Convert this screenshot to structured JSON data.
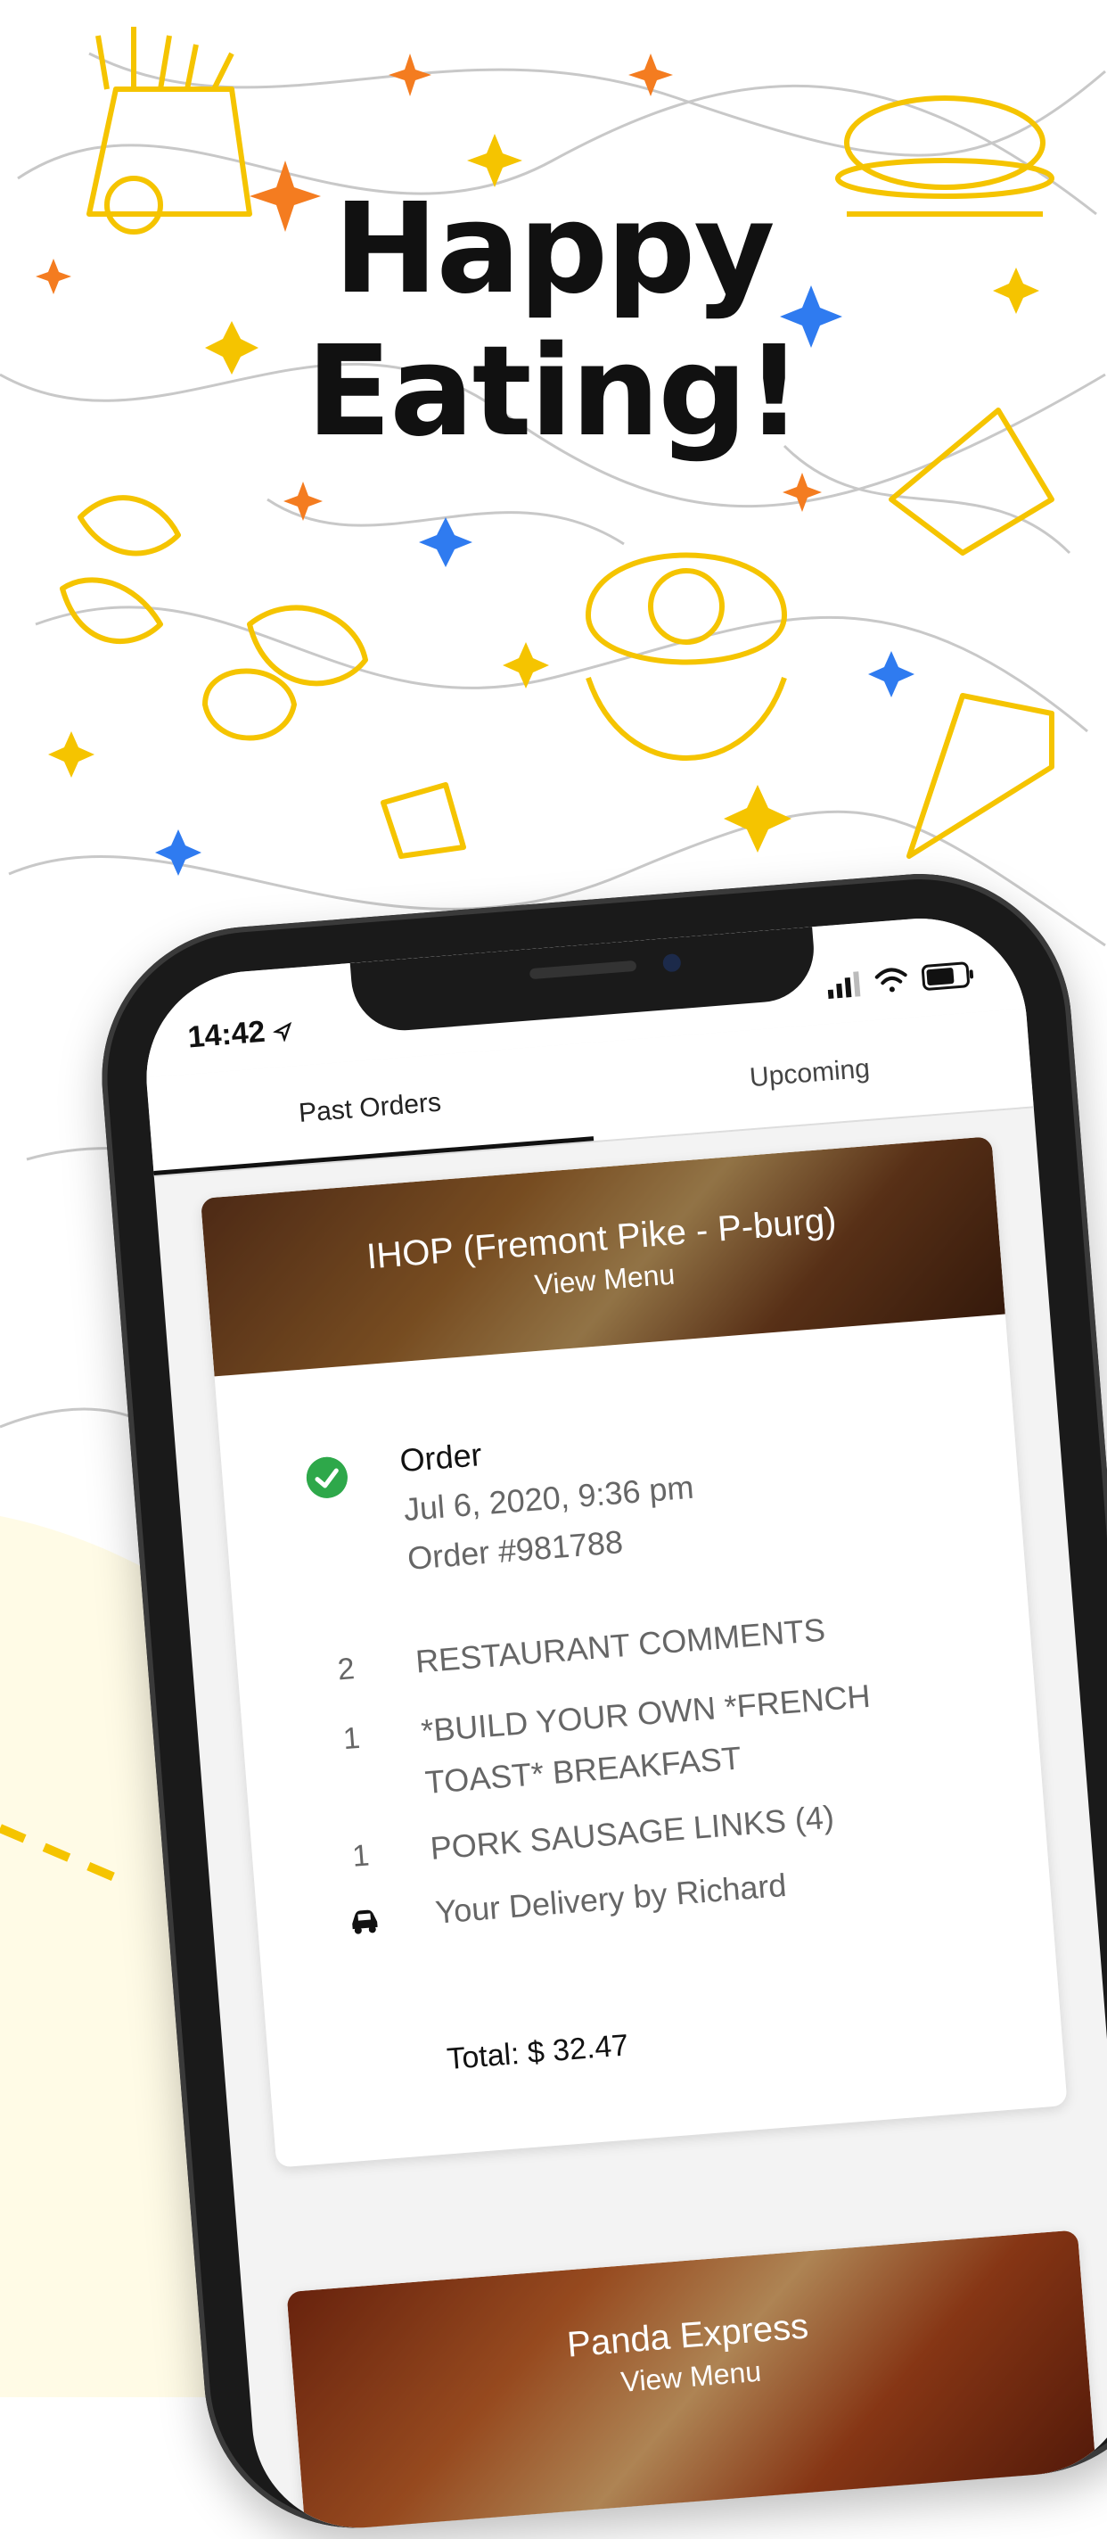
{
  "headline": {
    "line1": "Happy",
    "line2": "Eating!"
  },
  "status_bar": {
    "time": "14:42"
  },
  "tabs": [
    {
      "label": "Past Orders",
      "selected": true
    },
    {
      "label": "Upcoming",
      "selected": false
    }
  ],
  "orders": [
    {
      "restaurant": "IHOP (Fremont Pike - P-burg)",
      "view_menu": "View Menu",
      "status_label": "Order",
      "date": "Jul 6, 2020, 9:36 pm",
      "order_number": "Order #981788",
      "items": [
        {
          "qty": "2",
          "name": "RESTAURANT COMMENTS"
        },
        {
          "qty": "1",
          "name": "*BUILD YOUR OWN *FRENCH TOAST* BREAKFAST"
        },
        {
          "qty": "1",
          "name": "PORK SAUSAGE LINKS (4)"
        }
      ],
      "delivery": "Your Delivery by Richard",
      "total": "Total: $ 32.47"
    },
    {
      "restaurant": "Panda Express",
      "view_menu": "View Menu"
    }
  ],
  "colors": {
    "accent_yellow": "#f5c400",
    "accent_orange": "#f47c20",
    "accent_blue": "#2f7bf0",
    "success_green": "#2ea84a"
  },
  "icons": {
    "location": "location-arrow-icon",
    "signal": "signal-icon",
    "wifi": "wifi-icon",
    "battery": "battery-icon",
    "check": "check-circle-icon",
    "car": "car-icon"
  }
}
